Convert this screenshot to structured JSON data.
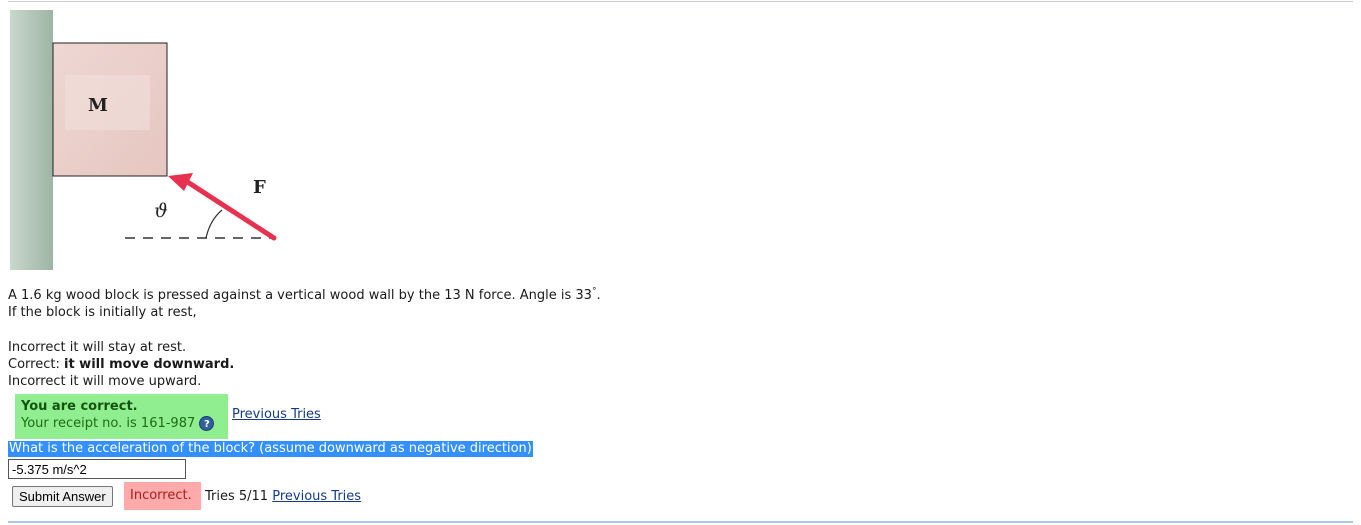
{
  "figure": {
    "block_label": "M",
    "force_label": "F",
    "angle_label": "ϑ"
  },
  "problem": {
    "statement_main": "A 1.6 kg wood block is pressed against a vertical wood wall by the 13 N force. Angle is 33",
    "statement_degree": "°",
    "statement_end": ".",
    "prompt": "If the block is initially at rest,"
  },
  "choices": [
    {
      "status": "Incorrect",
      "text": "it will stay at rest."
    },
    {
      "status": "Correct:",
      "text": "it will move downward."
    },
    {
      "status": "Incorrect",
      "text": "it will move upward."
    }
  ],
  "feedback_correct": {
    "title": "You are correct.",
    "receipt": "Your receipt no. is 161-987",
    "help_icon": "question-mark-icon",
    "previous_tries": "Previous Tries",
    "color": "#90ee90"
  },
  "question": {
    "text": "What is the acceleration of the block? (assume downward as negative direction)",
    "answer_value": "-5.375 m/s^2",
    "highlight_color": "#3390ff"
  },
  "submit": {
    "button_label": "Submit Answer",
    "feedback": "Incorrect.",
    "feedback_color": "#ffaaaa",
    "tries": "Tries 5/11",
    "previous_tries": "Previous Tries"
  }
}
